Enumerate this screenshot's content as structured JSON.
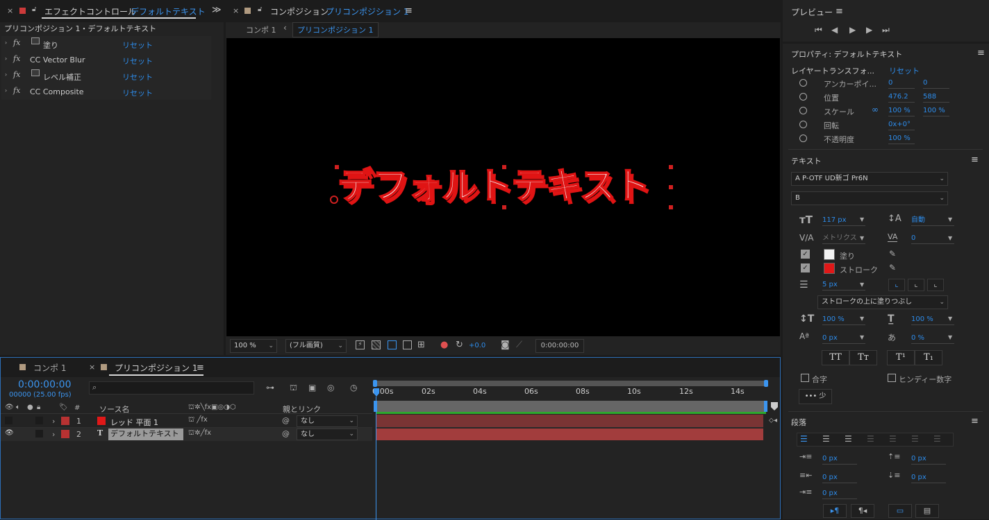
{
  "effect_panel": {
    "close": "×",
    "title": "エフェクトコントロール",
    "title_target": "デフォルトテキスト",
    "menu": "≫",
    "layer_path": "プリコンポジション 1・デフォルトテキスト",
    "effects": [
      {
        "name": "塗り",
        "reset": "リセット"
      },
      {
        "name": "CC Vector Blur",
        "reset": "リセット"
      },
      {
        "name": "レベル補正",
        "reset": "リセット"
      },
      {
        "name": "CC Composite",
        "reset": "リセット"
      }
    ]
  },
  "comp_panel": {
    "close": "×",
    "title": "コンポジション",
    "title_target": "プリコンポジション 1",
    "menu": "≡",
    "crumb1": "コンポ 1",
    "crumb2": "プリコンポジション 1",
    "canvas_text": "デフォルトテキスト",
    "footer": {
      "zoom": "100 %",
      "quality": "(フル画質)",
      "exposure": "+0.0",
      "timecode": "0:00:00:00"
    }
  },
  "preview": {
    "title": "プレビュー",
    "menu": "≡"
  },
  "properties": {
    "title": "プロパティ: デフォルトテキスト",
    "menu": "≡",
    "section": "レイヤートランスフォ...",
    "reset": "リセット",
    "rows": [
      {
        "label": "アンカーポイ...",
        "v1": "0",
        "v2": "0"
      },
      {
        "label": "位置",
        "v1": "476.2",
        "v2": "588"
      },
      {
        "label": "スケール",
        "v1": "100 %",
        "v2": "100 %"
      },
      {
        "label": "回転",
        "v1": "0x+0°",
        "v2": ""
      },
      {
        "label": "不透明度",
        "v1": "100 %",
        "v2": ""
      }
    ]
  },
  "text": {
    "title": "テキスト",
    "menu": "≡",
    "font": "A P-OTF UD新ゴ Pr6N",
    "style": "B",
    "size": "117 px",
    "leading": "自動",
    "kerning": "メトリクス",
    "tracking": "0",
    "fill_label": "塗り",
    "stroke_label": "ストローク",
    "stroke_width": "5 px",
    "stroke_mode": "ストロークの上に塗りつぶし",
    "v_scale": "100 %",
    "h_scale": "100 %",
    "baseline": "0 px",
    "tsume": "0 %",
    "btn_tt": "TT",
    "btn_tt2": "Tт",
    "btn_sup": "T¹",
    "btn_sub": "T₁",
    "ligature": "合字",
    "hindi": "ヒンディー数字",
    "more": "••• 少",
    "fill_color": "#f2f2f2",
    "stroke_color": "#e01818"
  },
  "paragraph": {
    "title": "段落",
    "menu": "≡",
    "indent_left": "0 px",
    "space_before": "0 px",
    "indent_right": "0 px",
    "space_after": "0 px",
    "first_line": "0 px"
  },
  "timeline": {
    "tab1": "コンポ 1",
    "tab2_close": "×",
    "tab2": "プリコンポジション 1",
    "tab2_menu": "≡",
    "timecode": "0:00:00:00",
    "fps": "00000 (25.00 fps)",
    "search_placeholder": "",
    "col_num": "#",
    "col_source": "ソース名",
    "col_parent": "親とリンク",
    "layers": [
      {
        "num": "1",
        "name": "レッド 平面 1",
        "parent": "なし",
        "color": "#b83232"
      },
      {
        "num": "2",
        "name": "デフォルトテキスト",
        "parent": "なし",
        "color": "#b83232"
      }
    ],
    "ticks": [
      "0:00s",
      "02s",
      "04s",
      "06s",
      "08s",
      "10s",
      "12s",
      "14s"
    ]
  }
}
